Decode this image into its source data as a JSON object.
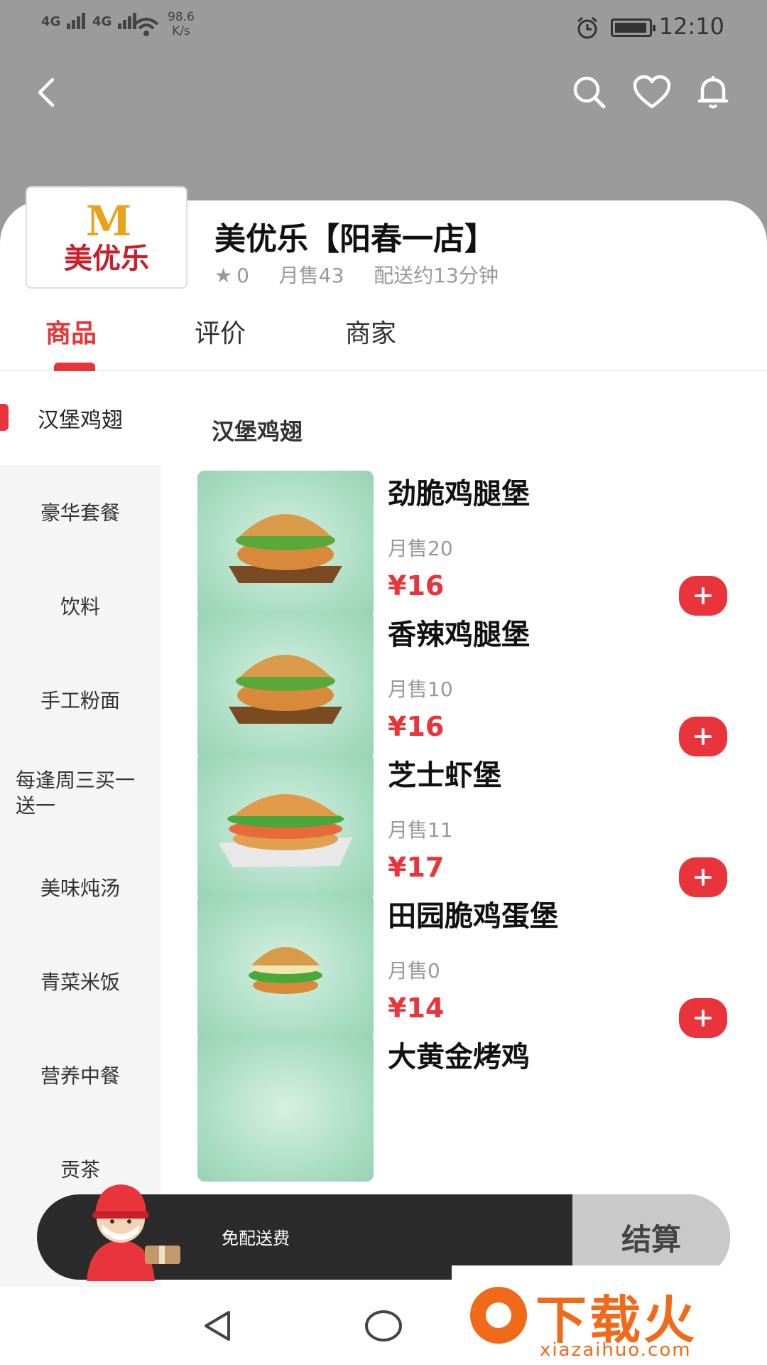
{
  "status_bar": {
    "signal1": "4G",
    "signal2": "4G",
    "speed_value": "98.6",
    "speed_unit": "K/s",
    "time": "12:10"
  },
  "header": {
    "back_icon": "chevron-left-icon",
    "search_icon": "search-icon",
    "favorite_icon": "heart-icon",
    "notification_icon": "bell-icon"
  },
  "shop": {
    "logo_mark": "M",
    "logo_text": "美优乐",
    "name": "美优乐【阳春一店】",
    "rating": "0",
    "monthly_sales": "月售43",
    "delivery_time": "配送约13分钟"
  },
  "tabs": [
    {
      "label": "商品",
      "active": true
    },
    {
      "label": "评价",
      "active": false
    },
    {
      "label": "商家",
      "active": false
    }
  ],
  "categories": [
    {
      "label": "汉堡鸡翅",
      "active": true
    },
    {
      "label": "豪华套餐"
    },
    {
      "label": "饮料"
    },
    {
      "label": "手工粉面"
    },
    {
      "label": "每逢周三买一送一"
    },
    {
      "label": "美味炖汤"
    },
    {
      "label": "青菜米饭"
    },
    {
      "label": "营养中餐"
    },
    {
      "label": "贡茶"
    }
  ],
  "section": {
    "title": "汉堡鸡翅"
  },
  "items": [
    {
      "name": "劲脆鸡腿堡",
      "sales": "月售20",
      "price": "¥16"
    },
    {
      "name": "香辣鸡腿堡",
      "sales": "月售10",
      "price": "¥16"
    },
    {
      "name": "芝士虾堡",
      "sales": "月售11",
      "price": "¥17"
    },
    {
      "name": "田园脆鸡蛋堡",
      "sales": "月售0",
      "price": "¥14"
    },
    {
      "name": "大黄金烤鸡",
      "sales": "",
      "price": ""
    }
  ],
  "cart": {
    "delivery_fee": "免配送费",
    "checkout_label": "结算"
  },
  "watermark": {
    "text": "下载火",
    "url": "xiazaihuo.com"
  },
  "colors": {
    "accent": "#e8343a",
    "header_bg": "#9b9b9b",
    "cart_bg": "#2b2b2b"
  }
}
